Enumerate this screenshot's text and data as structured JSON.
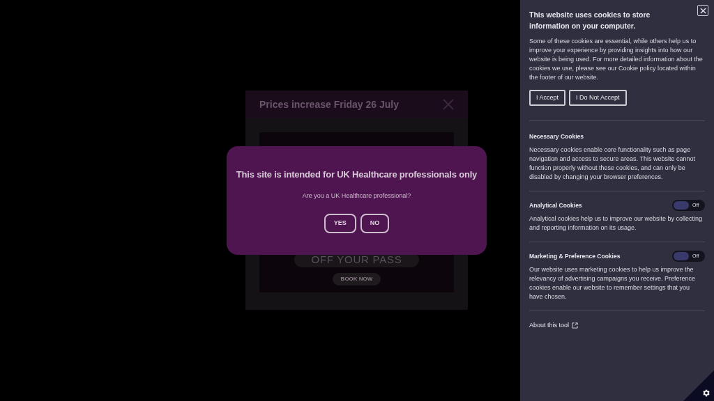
{
  "background_popup": {
    "title": "Prices increase Friday 26 July",
    "banner_text": "OFF YOUR PASS",
    "button": "BOOK NOW"
  },
  "modal": {
    "title": "This site is intended for UK Healthcare professionals only",
    "question": "Are you a UK Healthcare professional?",
    "buttons": [
      "YES",
      "NO"
    ]
  },
  "cookie_panel": {
    "title": "This website uses cookies to store information on your computer.",
    "intro": "Some of these cookies are essential, while others help us to improve your experience by providing insights into how our website is being used. For more detailed information about the cookies we use, please see our Cookie policy located within the footer of our website.",
    "buttons": [
      "I Accept",
      "I Do Not Accept"
    ],
    "sections": [
      {
        "kind": "text",
        "title": "Necessary Cookies",
        "description": "Necessary cookies enable core functionality such as page navigation and access to secure areas. This website cannot function properly without these cookies, and can only be disabled by changing your browser preferences."
      },
      {
        "kind": "toggle",
        "title": "Analytical Cookies",
        "on": false,
        "toggle_label": "Off",
        "description": "Analytical cookies help us to improve our website by collecting and reporting information on its usage."
      },
      {
        "kind": "toggle",
        "title": "Marketing & Preference Cookies",
        "on": false,
        "toggle_label": "Off",
        "description": "Our website uses marketing cookies to help us improve the relevancy of advertising campaigns you receive. Preference cookies enable our website to remember settings that you have chosen."
      }
    ],
    "about_link": "About this tool"
  }
}
